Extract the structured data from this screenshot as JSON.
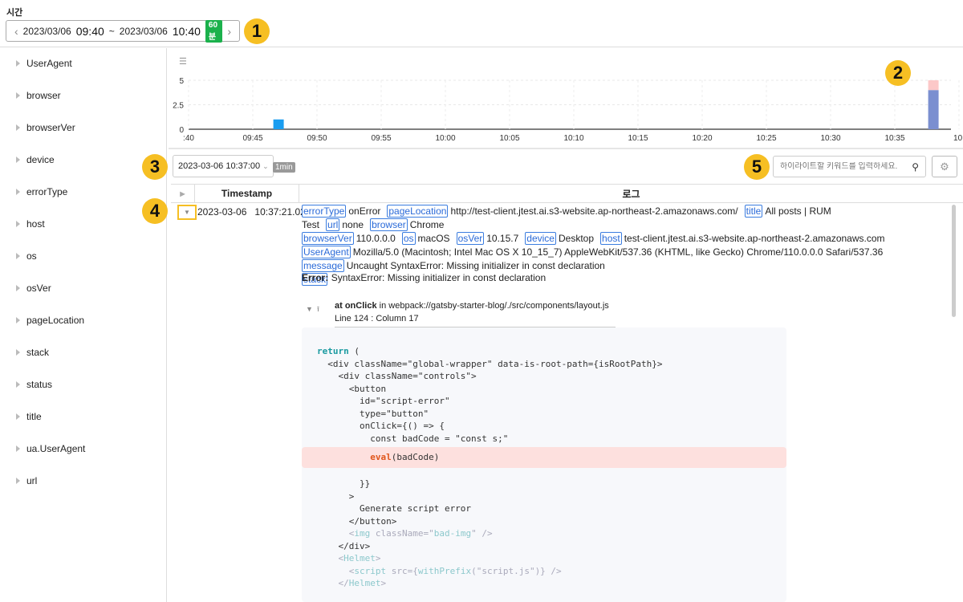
{
  "time": {
    "label": "시간",
    "start_date": "2023/03/06",
    "start_time": "09:40",
    "sep": "~",
    "end_date": "2023/03/06",
    "end_time": "10:40",
    "duration": "60분"
  },
  "callouts": [
    "1",
    "2",
    "3",
    "4",
    "5"
  ],
  "sidebar": {
    "items": [
      "UserAgent",
      "browser",
      "browserVer",
      "device",
      "errorType",
      "host",
      "os",
      "osVer",
      "pageLocation",
      "stack",
      "status",
      "title",
      "ua.UserAgent",
      "url"
    ]
  },
  "colors": {
    "accent": "#f6bf23",
    "bar_normal": "#1a9df0",
    "bar_series": "#7b8fd0",
    "bar_error": "#fcc8c8",
    "tag_green": "#1bb14c"
  },
  "chart_data": {
    "type": "bar",
    "stacked": true,
    "x_ticks": [
      ":40",
      "09:45",
      "09:50",
      "09:55",
      "10:00",
      "10:05",
      "10:10",
      "10:15",
      "10:20",
      "10:25",
      "10:30",
      "10:35",
      "10:"
    ],
    "y_ticks": [
      "0",
      "2.5",
      "5"
    ],
    "ylim": [
      0,
      5
    ],
    "series": [
      {
        "name": "logs",
        "color": "#1a9df0",
        "points": [
          {
            "x": "09:46",
            "y": 1
          }
        ]
      },
      {
        "name": "logs-selected",
        "color": "#7b8fd0",
        "points": [
          {
            "x": "10:37",
            "y": 4
          }
        ]
      },
      {
        "name": "errors",
        "color": "#fcc8c8",
        "points": [
          {
            "x": "10:37",
            "y": 1
          }
        ]
      }
    ]
  },
  "toolbar": {
    "date_select": "2023-03-06 10:37:00",
    "interval": "1min",
    "search_placeholder": "하이라이트할 키워드를 입력하세요."
  },
  "table": {
    "headers": [
      "Timestamp",
      "로그"
    ],
    "row": {
      "date": "2023-03-06",
      "time": "10:37:21.023",
      "lines": [
        [
          [
            "errorType",
            "onError"
          ],
          [
            "pageLocation",
            "http://test-client.jtest.ai.s3-website.ap-northeast-2.amazonaws.com/"
          ],
          [
            "title",
            "All posts | RUM Test"
          ],
          [
            "url",
            "none"
          ],
          [
            "browser",
            "Chrome"
          ]
        ],
        [
          [
            "browserVer",
            "110.0.0.0"
          ],
          [
            "os",
            "macOS"
          ],
          [
            "osVer",
            "10.15.7"
          ],
          [
            "device",
            "Desktop"
          ],
          [
            "host",
            "test-client.jtest.ai.s3-website.ap-northeast-2.amazonaws.com"
          ]
        ],
        [
          [
            "UserAgent",
            "Mozilla/5.0 (Macintosh; Intel Mac OS X 10_15_7) AppleWebKit/537.36 (KHTML, like Gecko) Chrome/110.0.0.0 Safari/537.36"
          ]
        ],
        [
          [
            "message",
            "Uncaught SyntaxError: Missing initializer in const declaration"
          ]
        ],
        [
          [
            "stack",
            ""
          ]
        ]
      ],
      "error_label": "Error:",
      "error_text": "SyntaxError: Missing initializer in const declaration",
      "frame": {
        "fn": "at onClick",
        "in": "in",
        "file": "webpack://gatsby-starter-blog/./src/components/layout.js",
        "pos": "Line 124 : Column 17"
      },
      "code": [
        [
          [
            "return",
            "kw"
          ],
          [
            " (",
            ""
          ]
        ],
        [
          [
            "  <div className=\"global-wrapper\" data-is-root-path={isRootPath}>",
            ""
          ]
        ],
        [
          [
            "    <div className=\"controls\">",
            ""
          ]
        ],
        [
          [
            "      <button",
            ""
          ]
        ],
        [
          [
            "        id=\"script-error\"",
            ""
          ]
        ],
        [
          [
            "        type=\"button\"",
            " "
          ]
        ],
        [
          [
            "        onClick={() => {",
            ""
          ]
        ],
        [
          [
            "          const badCode = \"const s;\"",
            ""
          ]
        ],
        [
          [
            "          ",
            ""
          ],
          [
            "eval",
            "err"
          ],
          [
            "(badCode)",
            ""
          ]
        ],
        [
          [
            "        }}",
            ""
          ]
        ],
        [
          [
            "      >",
            ""
          ]
        ],
        [
          [
            "        Generate script error",
            ""
          ]
        ],
        [
          [
            "      </button>",
            ""
          ]
        ],
        [
          [
            "      <",
            "f"
          ],
          [
            "img",
            "ft"
          ],
          [
            " className=\"",
            "f"
          ],
          [
            "bad-img",
            "ft"
          ],
          [
            "\" />",
            "f"
          ]
        ],
        [
          [
            "    </div>",
            ""
          ]
        ],
        [
          [
            "    <",
            "f"
          ],
          [
            "Helmet",
            "ft"
          ],
          [
            ">",
            "f"
          ]
        ],
        [
          [
            "      <",
            "f"
          ],
          [
            "script",
            "ft"
          ],
          [
            " src={",
            "f"
          ],
          [
            "withPrefix",
            "ft"
          ],
          [
            "(\"script.js\")} />",
            "f"
          ]
        ],
        [
          [
            "    </",
            "f"
          ],
          [
            "Helmet",
            "ft"
          ],
          [
            ">",
            "f"
          ]
        ]
      ]
    }
  }
}
